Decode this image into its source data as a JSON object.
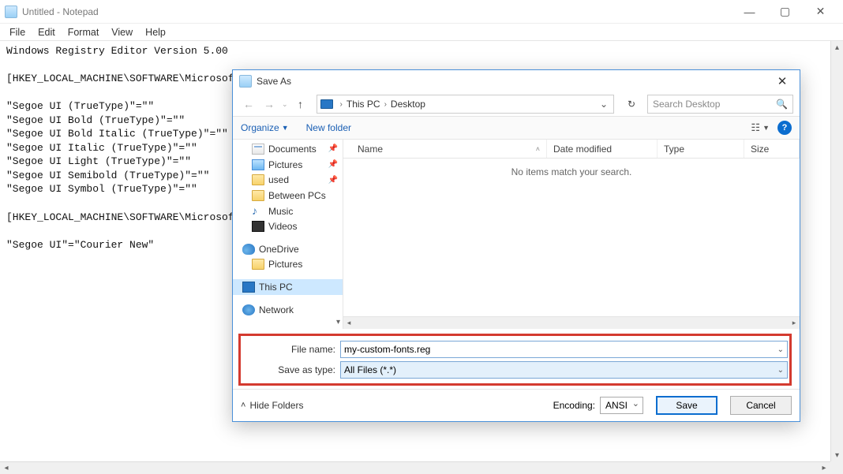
{
  "notepad": {
    "title": "Untitled - Notepad",
    "menu": {
      "file": "File",
      "edit": "Edit",
      "format": "Format",
      "view": "View",
      "help": "Help"
    },
    "content": "Windows Registry Editor Version 5.00\n\n[HKEY_LOCAL_MACHINE\\SOFTWARE\\Microsoft\n\n\"Segoe UI (TrueType)\"=\"\"\n\"Segoe UI Bold (TrueType)\"=\"\"\n\"Segoe UI Bold Italic (TrueType)\"=\"\"\n\"Segoe UI Italic (TrueType)\"=\"\"\n\"Segoe UI Light (TrueType)\"=\"\"\n\"Segoe UI Semibold (TrueType)\"=\"\"\n\"Segoe UI Symbol (TrueType)\"=\"\"\n\n[HKEY_LOCAL_MACHINE\\SOFTWARE\\Microsof\n\n\"Segoe UI\"=\"Courier New\""
  },
  "dialog": {
    "title": "Save As",
    "breadcrumb": {
      "root": "This PC",
      "leaf": "Desktop"
    },
    "search_placeholder": "Search Desktop",
    "toolbar": {
      "organize": "Organize",
      "newfolder": "New folder"
    },
    "columns": {
      "name": "Name",
      "date": "Date modified",
      "type": "Type",
      "size": "Size"
    },
    "empty_text": "No items match your search.",
    "nav": {
      "documents": "Documents",
      "pictures": "Pictures",
      "used": "used",
      "betweenpcs": "Between PCs",
      "music": "Music",
      "videos": "Videos",
      "onedrive": "OneDrive",
      "onedrive_pictures": "Pictures",
      "thispc": "This PC",
      "network": "Network"
    },
    "labels": {
      "filename": "File name:",
      "saveas": "Save as type:",
      "encoding": "Encoding:",
      "hidefolders": "Hide Folders"
    },
    "filename_value": "my-custom-fonts.reg",
    "savetype_value": "All Files  (*.*)",
    "encoding_value": "ANSI",
    "buttons": {
      "save": "Save",
      "cancel": "Cancel"
    }
  }
}
